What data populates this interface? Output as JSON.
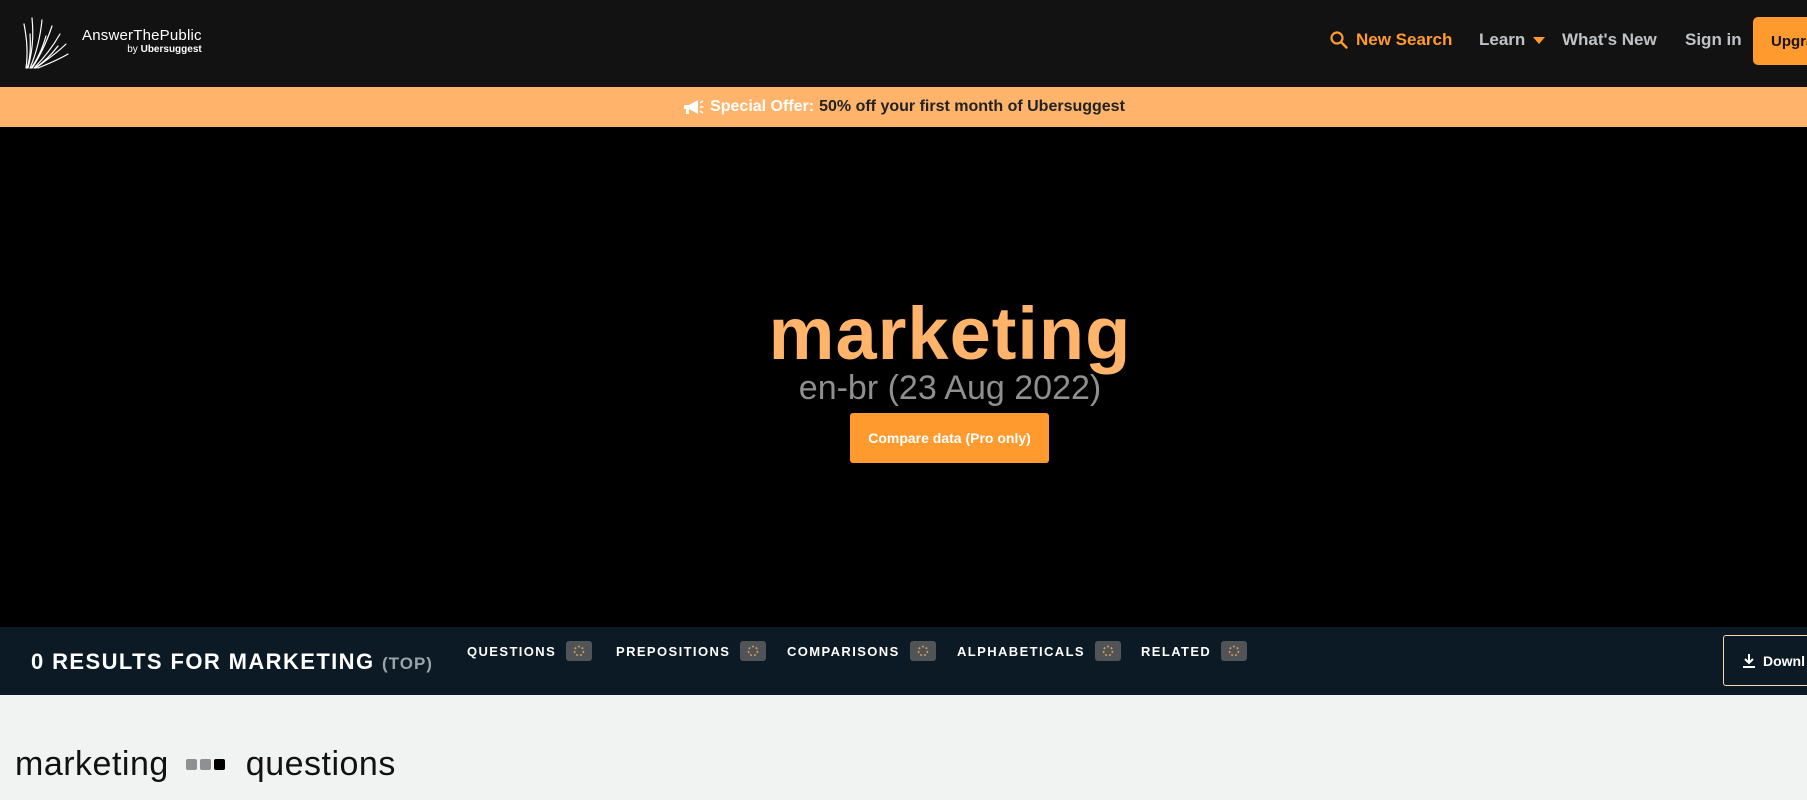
{
  "header": {
    "logo": {
      "name": "AnswerThePublic",
      "by": "by",
      "brand": "Ubersuggest"
    },
    "nav": {
      "new_search": "New Search",
      "learn": "Learn",
      "whats_new": "What's New",
      "sign_in": "Sign in",
      "upgrade": "Upgra"
    }
  },
  "offer": {
    "label": "Special Offer:",
    "text": "50% off your first month of Ubersuggest"
  },
  "hero": {
    "keyword": "marketing",
    "meta": "en-br (23 Aug 2022)",
    "compare_button": "Compare data (Pro only)"
  },
  "results": {
    "count_label": "0 RESULTS FOR MARKETING",
    "mode": "(TOP)",
    "tabs": [
      {
        "label": "QUESTIONS"
      },
      {
        "label": "PREPOSITIONS"
      },
      {
        "label": "COMPARISONS"
      },
      {
        "label": "ALPHABETICALS"
      },
      {
        "label": "RELATED"
      }
    ],
    "download": "Downl"
  },
  "section": {
    "keyword": "marketing",
    "type": "questions"
  },
  "colors": {
    "accent": "#ff9a2e",
    "accent_light": "#ffb36b",
    "header_bg": "#121212",
    "hero_bg": "#000000",
    "results_bar_bg": "#0b1a24",
    "page_bg": "#f1f2f2"
  }
}
